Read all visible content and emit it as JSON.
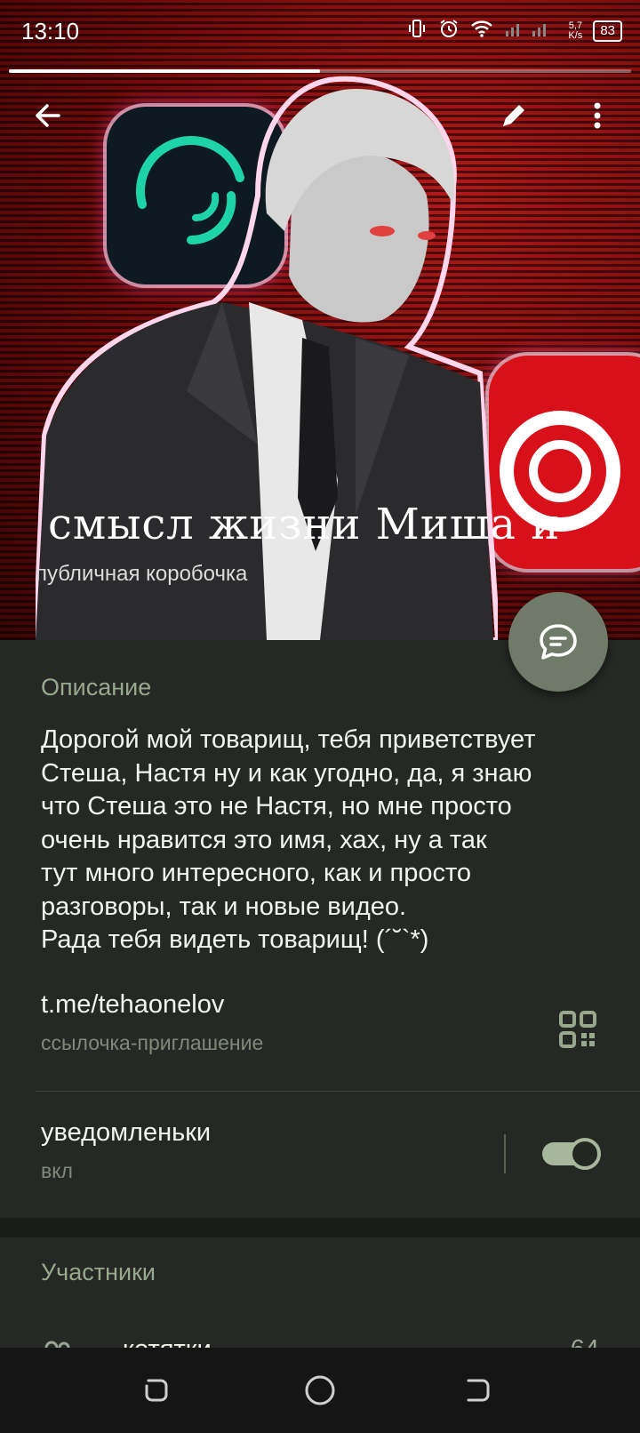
{
  "status_bar": {
    "time": "13:10",
    "net_speed_value": "5,7",
    "net_speed_unit": "K/s",
    "battery": "83"
  },
  "story_progress": 0.5,
  "channel": {
    "title": "смысл жизни   Миша и",
    "subtitle": "публичная коробочка"
  },
  "description": {
    "heading": "Описание",
    "text": "Дорогой мой товарищ, тебя приветствует\nСтеша, Настя ну и как угодно, да, я знаю\nчто Стеша это не Настя, но мне просто\nочень нравится это имя, хах, ну а так\nтут много интересного, как и просто\nразговоры, так и новые видео.\nРада тебя видеть товарищ! (´˘`*)"
  },
  "invite_link": {
    "url": "t.me/tehaonelov",
    "label": "ссылочка-приглашение"
  },
  "notifications": {
    "label": "уведомленьки",
    "state": "вкл",
    "enabled": true
  },
  "members": {
    "heading": "Участники",
    "row_label": "котятки",
    "row_count": "64"
  },
  "colors": {
    "accent": "#98a88d",
    "fab": "#6f7b68",
    "toggle": "#a7b79c",
    "panel": "#252824"
  },
  "icons": {
    "back": "arrow-left-icon",
    "edit": "pencil-icon",
    "more": "more-vertical-icon",
    "fab": "chat-bubble-icon",
    "qr": "qr-code-icon",
    "members": "people-icon"
  }
}
